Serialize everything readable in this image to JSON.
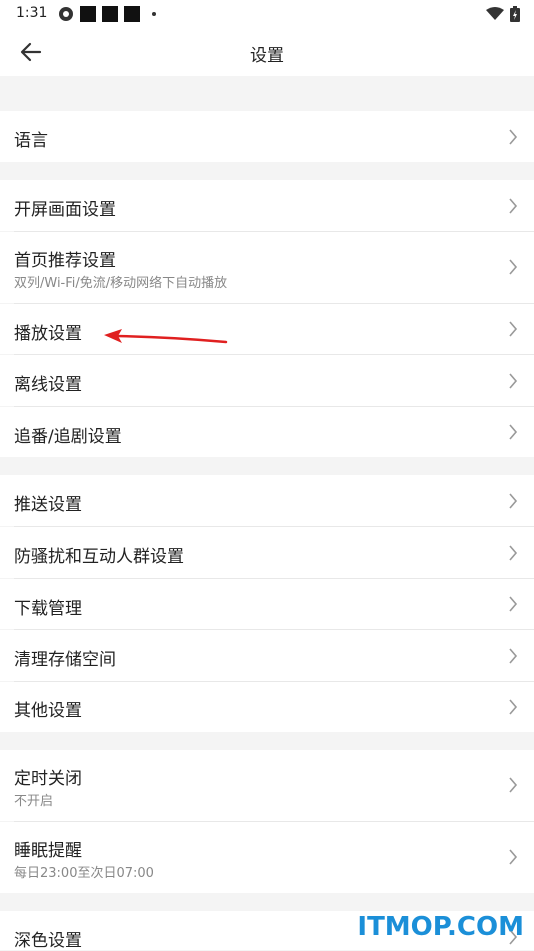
{
  "status": {
    "time": "1:31"
  },
  "header": {
    "title": "设置"
  },
  "items": [
    {
      "label": "语言"
    },
    {
      "label": "开屏画面设置"
    },
    {
      "label": "首页推荐设置",
      "sub": "双列/Wi-Fi/免流/移动网络下自动播放"
    },
    {
      "label": "播放设置"
    },
    {
      "label": "离线设置"
    },
    {
      "label": "追番/追剧设置"
    },
    {
      "label": "推送设置"
    },
    {
      "label": "防骚扰和互动人群设置"
    },
    {
      "label": "下载管理"
    },
    {
      "label": "清理存储空间"
    },
    {
      "label": "其他设置"
    },
    {
      "label": "定时关闭",
      "sub": "不开启"
    },
    {
      "label": "睡眠提醒",
      "sub": "每日23:00至次日07:00"
    },
    {
      "label": "深色设置"
    }
  ],
  "watermark": "ITMOP.COM",
  "colors": {
    "watermark": "#1b8fd8",
    "arrow": "#e02020"
  }
}
